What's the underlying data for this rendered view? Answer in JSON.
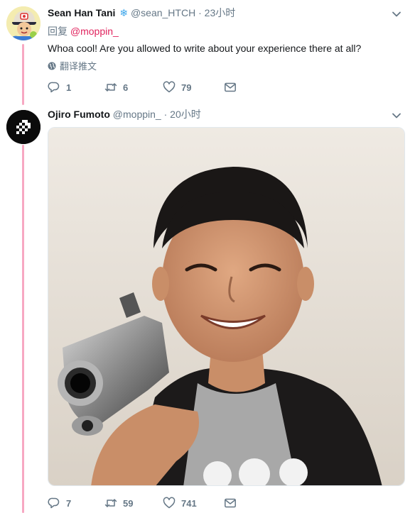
{
  "tweets": [
    {
      "display_name": "Sean Han Tani",
      "badge": "❄",
      "handle": "@sean_HTCH",
      "separator": "·",
      "time": "23小时",
      "reply_prefix": "回复",
      "reply_to": "@moppin_",
      "text": "Whoa cool! Are you allowed to write about your experience there at all?",
      "translate_label": "翻译推文",
      "replies": "1",
      "retweets": "6",
      "likes": "79"
    },
    {
      "display_name": "Ojiro Fumoto",
      "handle": "@moppin_",
      "separator": "·",
      "time": "20小时",
      "replies": "7",
      "retweets": "59",
      "likes": "741"
    }
  ],
  "icons": {
    "reply": "reply-icon",
    "retweet": "retweet-icon",
    "like": "heart-icon",
    "dm": "envelope-icon",
    "caret": "chevron-down-icon",
    "translate": "globe-icon"
  },
  "colors": {
    "thread_line": "#f7a8c2",
    "mention": "#e0245e",
    "secondary_text": "#657786",
    "verified_blue": "#3ba5ea"
  }
}
